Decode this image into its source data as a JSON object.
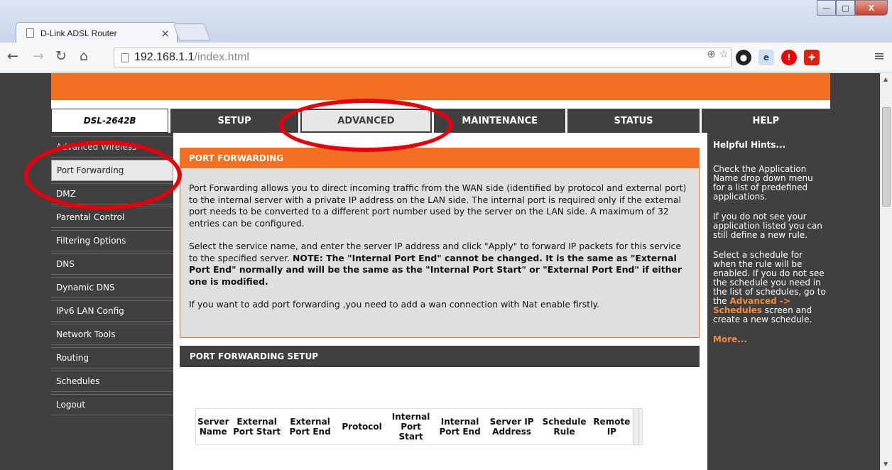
{
  "browser": {
    "tab_title": "D-Link ADSL Router",
    "tab_close": "×",
    "url_host": "192.168.1.1",
    "url_path": "/index.html",
    "win_min": "—",
    "win_max": "□",
    "win_close": "X"
  },
  "router": {
    "model": "DSL-2642B",
    "tabs": [
      "SETUP",
      "ADVANCED",
      "MAINTENANCE",
      "STATUS",
      "HELP"
    ],
    "active_tab": "ADVANCED",
    "sidebar": [
      "Advanced Wireless",
      "Port Forwarding",
      "DMZ",
      "Parental Control",
      "Filtering Options",
      "DNS",
      "Dynamic DNS",
      "IPv6 LAN Config",
      "Network Tools",
      "Routing",
      "Schedules",
      "Logout"
    ],
    "active_sidebar": "Port Forwarding"
  },
  "port_forwarding": {
    "title": "PORT FORWARDING",
    "para1": "Port Forwarding allows you to direct incoming traffic from the WAN side (identified by protocol and external port) to the internal server with a private IP address on the LAN side. The internal port is required only if the external port needs to be converted to a different port number used by the server on the LAN side. A maximum of 32 entries can be configured.",
    "para2_plain": "Select the service name, and enter the server IP address and click \"Apply\" to forward IP packets for this service to the specified server. ",
    "para2_bold": "NOTE: The \"Internal Port End\" cannot be changed. It is the same as \"External Port End\" normally and will be the same as the \"Internal Port Start\" or \"External Port End\" if either one is modified.",
    "para3": "If you want to add port forwarding ,you need to add a wan connection with Nat enable firstly."
  },
  "setup": {
    "title": "PORT FORWARDING SETUP",
    "columns": [
      "Server Name",
      "External Port Start",
      "External Port End",
      "Protocol",
      "Internal Port Start",
      "Internal Port End",
      "Server IP Address",
      "Schedule Rule",
      "Remote IP"
    ]
  },
  "hints": {
    "title": "Helpful Hints...",
    "p1": "Check the Application Name drop down menu for a list of predefined applications.",
    "p2": "If you do not see your application listed you can still define a new rule.",
    "p3_a": "Select a schedule for when the rule will be enabled. If you do not see the schedule you need in the list of schedules, go to the ",
    "p3_link": "Advanced -> Schedules",
    "p3_b": " screen and create a new schedule.",
    "more": "More..."
  }
}
